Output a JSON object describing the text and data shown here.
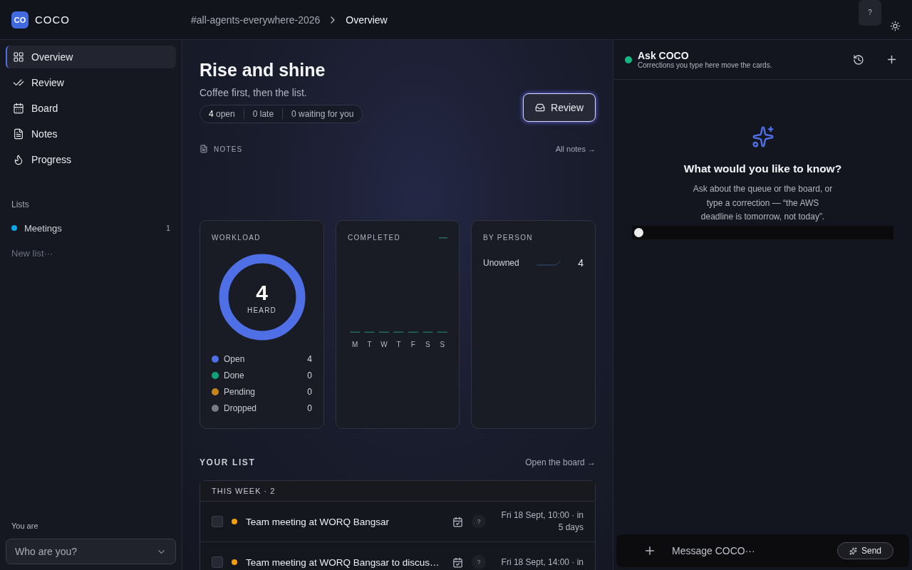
{
  "app": {
    "logo": "CO",
    "name": "COCO"
  },
  "breadcrumb": [
    "#all-agents-everywhere-2026",
    "Overview"
  ],
  "header": {
    "help": "?"
  },
  "sidebar": {
    "nav": [
      {
        "kind": "overview",
        "label": "Overview",
        "selected": true
      },
      {
        "kind": "review",
        "label": "Review",
        "selected": false
      },
      {
        "kind": "board",
        "label": "Board",
        "selected": false
      },
      {
        "kind": "notes",
        "label": "Notes",
        "selected": false
      },
      {
        "kind": "progress",
        "label": "Progress",
        "selected": false
      }
    ],
    "lists_heading": "Lists",
    "lists": [
      {
        "label": "Meetings",
        "count": "1",
        "color": "#0ea5e9"
      }
    ],
    "new_list": "New list···",
    "user_label": "You are",
    "user_select": {
      "placeholder": "Who are you?"
    }
  },
  "main": {
    "title": "Rise and shine",
    "subtitle": "Coffee first, then the list.",
    "stats": [
      "**4** open",
      "0 late",
      "0 waiting for you"
    ],
    "review_button": "Review",
    "notes": {
      "heading": "NOTES",
      "link": "All notes →"
    },
    "workload": {
      "heading": "WORKLOAD",
      "total": "4",
      "total_label": "HEARD",
      "legend": [
        {
          "label": "Open",
          "value": "4",
          "color": "#4f6fe6"
        },
        {
          "label": "Done",
          "value": "0",
          "color": "#10a37a"
        },
        {
          "label": "Pending",
          "value": "0",
          "color": "#c7841a"
        },
        {
          "label": "Dropped",
          "value": "0",
          "color": "#7a7b80"
        }
      ]
    },
    "completed": {
      "heading": "COMPLETED",
      "days": [
        "M",
        "T",
        "W",
        "T",
        "F",
        "S",
        "S"
      ]
    },
    "by_person": {
      "heading": "BY PERSON",
      "people": [
        {
          "name": "Unowned",
          "count": "4"
        }
      ]
    },
    "your_list": {
      "heading": "YOUR LIST",
      "link": "Open the board →",
      "group": {
        "heading": "THIS WEEK · 2",
        "rows": [
          {
            "checked": false,
            "color": "#f59e0b",
            "title": "Team meeting at WORQ Bangsar",
            "owner": "?",
            "due": "Fri 18 Sept, 10:00 · in 5 days"
          },
          {
            "checked": false,
            "color": "#f59e0b",
            "title": "Team meeting at WORQ Bangsar to discus…",
            "owner": "?",
            "due": "Fri 18 Sept, 14:00 · in"
          }
        ]
      }
    }
  },
  "assistant": {
    "title": "Ask COCO",
    "subtitle": "Corrections you type here move the cards.",
    "empty_title": "What would you like to know?",
    "empty_body": "Ask about the queue or the board, or type a correction — “the AWS deadline is tomorrow, not today”.",
    "slider": {
      "level": 0
    },
    "composer": {
      "placeholder": "Message COCO···",
      "send": "Send"
    }
  }
}
